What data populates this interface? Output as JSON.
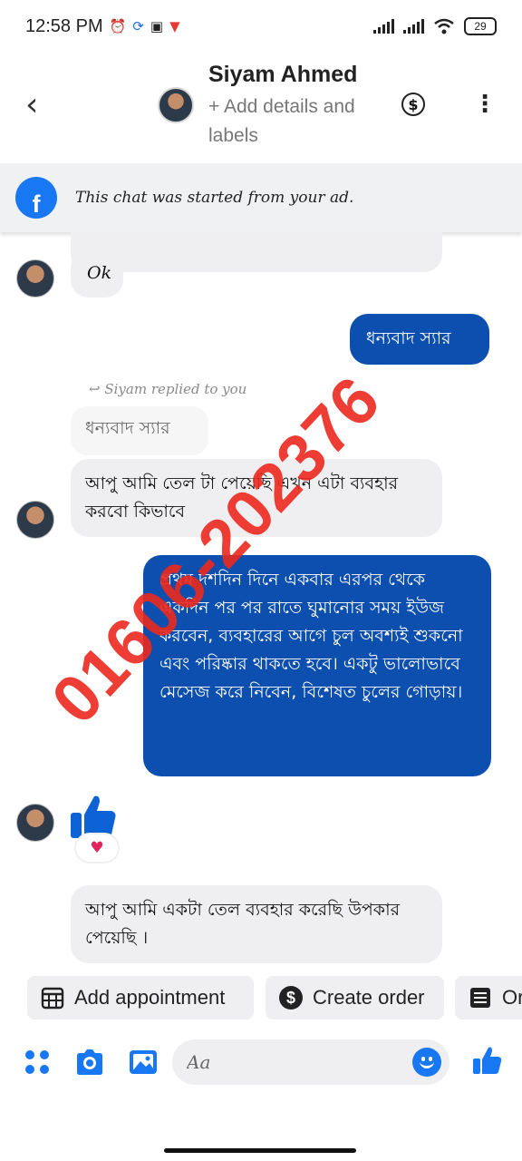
{
  "status_bar": {
    "time": "12:58 PM",
    "battery": "29"
  },
  "header": {
    "contact_name": "Siyam Ahmed",
    "subtitle": "+ Add details and labels"
  },
  "ad_banner": {
    "text": "This chat was started from your ad."
  },
  "messages": {
    "ok": "Ok",
    "thanks_out": "ধন্যবাদ স্যার",
    "reply_note": "Siyam replied to you",
    "quoted": "ধন্যবাদ স্যার",
    "question": "আপু আমি তেল টা পেয়েছি এখন এটা ব্যবহার করবো কিভাবে",
    "instructions": "প্রথম দশদিন দিনে একবার এরপর থেকে একদিন পর পর রাতে ঘুমানোর সময় ইউজ করবেন, ব্যবহারের আগে চুল অবশ্যই শুকনো এবং পরিষ্কার থাকতে হবে। একটু ভালোভাবে মেসেজ করে নিবেন, বিশেষত চুলের গোড়ায়।",
    "feedback": "আপু আমি একটা তেল ব্যবহার করেছি উপকার পেয়েছি ।",
    "reaction": "♥"
  },
  "watermark": "01606-202376",
  "quick_actions": {
    "appointment": "Add appointment",
    "order": "Create order",
    "third": "Or"
  },
  "composer": {
    "placeholder": "Aa"
  },
  "colors": {
    "brand_blue": "#1877f2",
    "outgoing_bubble": "#0d4fae",
    "incoming_bubble": "#efeff1",
    "watermark_red": "#eb281e"
  }
}
